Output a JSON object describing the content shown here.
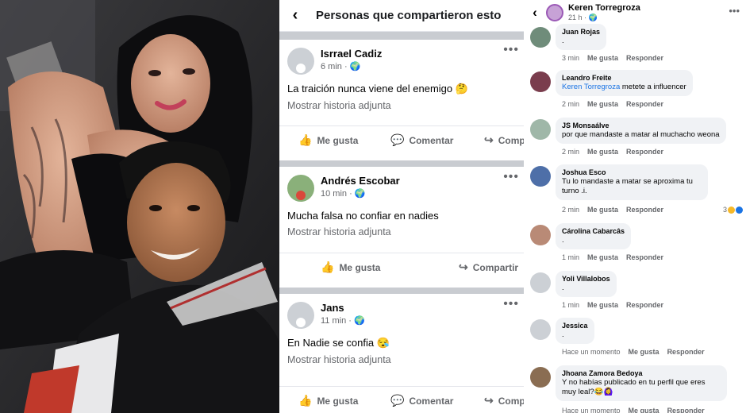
{
  "middle": {
    "title": "Personas que compartieron esto",
    "posts": [
      {
        "name": "Isrrael Cadiz",
        "time": "6 min · 🌍",
        "text": "La traición nunca viene del enemigo 🤔",
        "attach": "Mostrar historia adjunta",
        "like": "Me gusta",
        "comment": "Comentar",
        "share": "Compartir"
      },
      {
        "name": "Andrés Escobar",
        "time": "10 min · 🌍",
        "text": "Mucha falsa no confiar en nadies",
        "attach": "Mostrar historia adjunta",
        "like": "Me gusta",
        "share": "Compartir"
      },
      {
        "name": "Jans",
        "time": "11 min · 🌍",
        "text": "En Nadie se confia 😪",
        "attach": "Mostrar historia adjunta",
        "like": "Me gusta",
        "comment": "Comentar",
        "share": "Compartir"
      }
    ]
  },
  "right": {
    "header": {
      "name": "Keren Torregroza",
      "time": "21 h · 🌍"
    },
    "comments": [
      {
        "name": "Juan Rojas",
        "text": ".",
        "time": "3 min",
        "like": "Me gusta",
        "reply": "Responder"
      },
      {
        "name": "Leandro Freite",
        "tag": "Keren Torregroza",
        "text": " metete a influencer",
        "time": "2 min",
        "like": "Me gusta",
        "reply": "Responder"
      },
      {
        "name": "JS Monsaálve",
        "text": "por que mandaste a matar al muchacho weona",
        "time": "2 min",
        "like": "Me gusta",
        "reply": "Responder"
      },
      {
        "name": "Joshua Esco",
        "text": "Tu lo mandaste a matar se aproxima tu turno .i.",
        "time": "2 min",
        "like": "Me gusta",
        "reply": "Responder",
        "reactions": "3"
      },
      {
        "name": "Cárolina Cabarcâs",
        "text": ".",
        "time": "1 min",
        "like": "Me gusta",
        "reply": "Responder"
      },
      {
        "name": "Yoli Villalobos",
        "text": ".",
        "time": "1 min",
        "like": "Me gusta",
        "reply": "Responder"
      },
      {
        "name": "Jessica",
        "text": ".",
        "time": "Hace un momento",
        "like": "Me gusta",
        "reply": "Responder"
      },
      {
        "name": "Jhoana Zamora Bedoya",
        "text": "Y no habías publicado en tu perfil que eres muy leal?😂🙆‍♀️",
        "time": "Hace un momento",
        "like": "Me gusta",
        "reply": "Responder"
      }
    ]
  },
  "colors": {
    "link": "#1b74e4",
    "muted": "#65676b",
    "bubble": "#f0f2f5",
    "separator": "#c9ccd1"
  }
}
